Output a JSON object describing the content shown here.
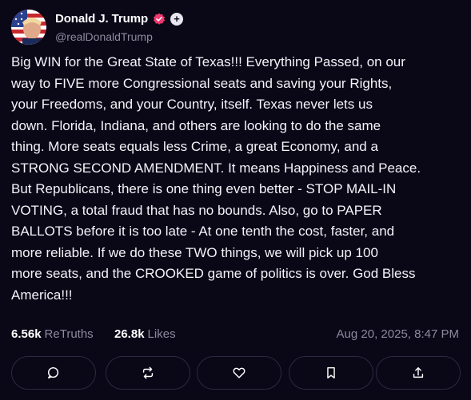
{
  "post": {
    "author_name": "Donald J. Trump",
    "author_handle": "@realDonaldTrump",
    "text": "Big WIN for the Great State of Texas!!! Everything Passed, on our\nway to FIVE more Congressional seats and saving your Rights,\nyour Freedoms, and your Country, itself. Texas never lets us\ndown. Florida, Indiana, and others are looking to do the same\nthing. More seats equals less Crime, a great Economy, and a\nSTRONG SECOND AMENDMENT. It means Happiness and Peace.\nBut Republicans, there is one thing even better - STOP MAIL-IN\nVOTING, a total fraud that has no bounds. Also, go to PAPER\nBALLOTS before it is too late - At one tenth the cost, faster, and\nmore reliable. If we do these TWO things, we will pick up 100\nmore seats, and the CROOKED game of politics is over. God Bless\nAmerica!!!",
    "retruths_count": "6.56k",
    "retruths_label": "ReTruths",
    "likes_count": "26.8k",
    "likes_label": "Likes",
    "timestamp": "Aug 20, 2025, 8:47 PM"
  },
  "badges": {
    "verified_icon": "verified-badge-icon",
    "plus_icon": "plus-icon",
    "plus_glyph": "+"
  },
  "actions": [
    {
      "name": "reply",
      "icon": "comment-icon"
    },
    {
      "name": "retruth",
      "icon": "repost-icon"
    },
    {
      "name": "like",
      "icon": "heart-icon"
    },
    {
      "name": "bookmark",
      "icon": "bookmark-icon"
    },
    {
      "name": "share",
      "icon": "share-icon"
    }
  ],
  "colors": {
    "background": "#0a0717",
    "text_primary": "#ffffff",
    "text_secondary": "#8e8a9e",
    "verified_badge": "#f0396f",
    "button_border": "#2e2940"
  }
}
